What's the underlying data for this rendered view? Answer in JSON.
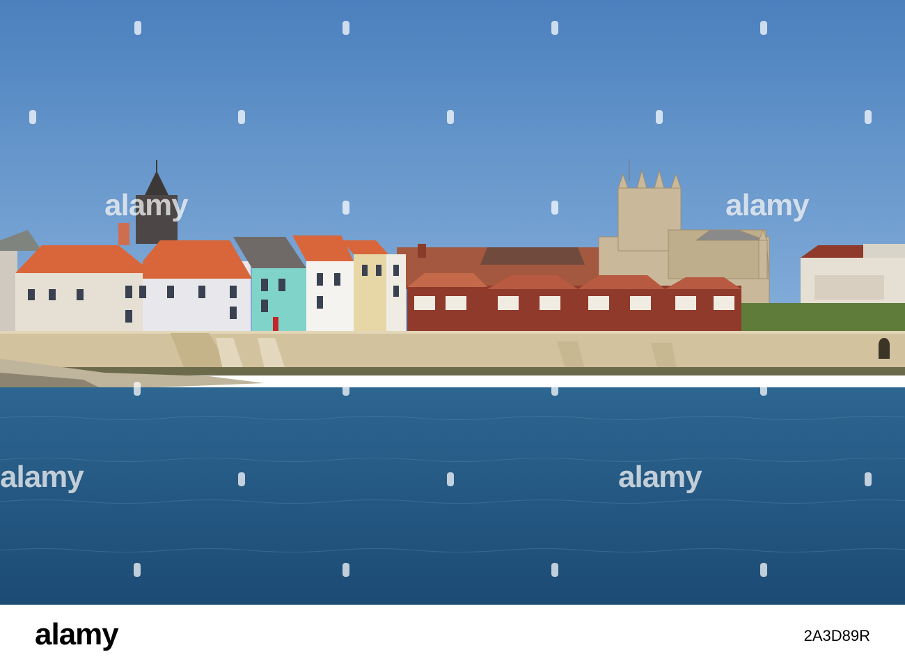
{
  "image": {
    "scene": "coastal-town-seafront",
    "colors": {
      "sky_top": "#4f86c0",
      "sky_bottom": "#7aa6d6",
      "sea": "#23557f",
      "sea_wall": "#d2c29d",
      "roof_orange": "#d9663b",
      "house_teal": "#7fd3c9",
      "brick_red": "#8f3a2b"
    }
  },
  "watermark": {
    "text": "alamy"
  },
  "footer": {
    "logo": "alamy",
    "image_id": "2A3D89R"
  }
}
